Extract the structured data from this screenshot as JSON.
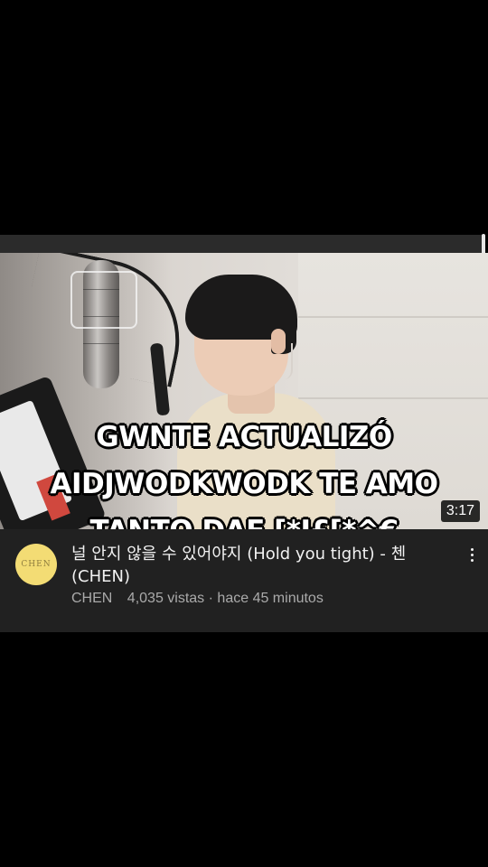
{
  "video": {
    "overlay_caption": {
      "line1": "GWNTE ACTUALIZÓ",
      "line2": "AIDJWODKWODK TE AMO",
      "line3": "TANTO DAE [*I£[*^€"
    },
    "duration": "3:17"
  },
  "info": {
    "avatar_text": "CHEN",
    "title": "널 안지 않을 수 있어야지 (Hold you tight) - 첸 (CHEN)",
    "channel_name": "CHEN",
    "separator": "·",
    "views": "4,035 vistas",
    "age": "hace 45 minutos"
  },
  "icons": {
    "more": "more-vert-icon"
  },
  "colors": {
    "background": "#000000",
    "info_bar": "#212121",
    "title_text": "#f1f1f1",
    "meta_text": "#aaaaaa",
    "avatar_bg": "#f3dc74"
  }
}
